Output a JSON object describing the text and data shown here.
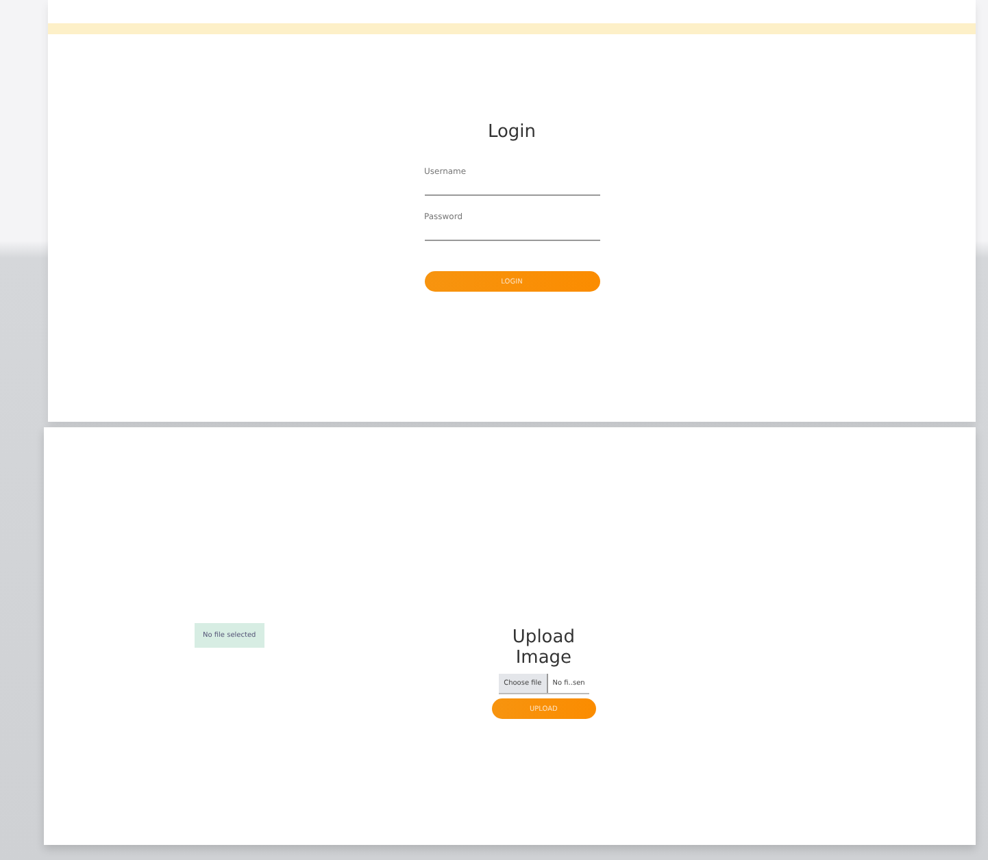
{
  "login": {
    "title": "Login",
    "fields": [
      {
        "label": "Username"
      },
      {
        "label": "Password"
      }
    ],
    "button": "LOGIN"
  },
  "upload": {
    "status": "No file selected",
    "title": "Upload Image",
    "choose_button": "Choose file",
    "file_name": "No fi..sen",
    "button": "UPLOAD"
  }
}
